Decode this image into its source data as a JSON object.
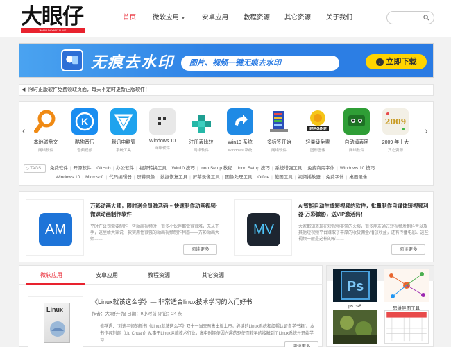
{
  "header": {
    "logo_text": "大眼仔",
    "logo_sub": "WWW.DAYANZAI.ME",
    "nav": [
      {
        "label": "首页",
        "active": true,
        "has_caret": false
      },
      {
        "label": "微软应用",
        "active": false,
        "has_caret": true
      },
      {
        "label": "安卓应用",
        "active": false,
        "has_caret": false
      },
      {
        "label": "教程资源",
        "active": false,
        "has_caret": false
      },
      {
        "label": "其它资源",
        "active": false,
        "has_caret": false
      },
      {
        "label": "关于我们",
        "active": false,
        "has_caret": false
      }
    ],
    "search_placeholder": ""
  },
  "banner": {
    "title": "无痕去水印",
    "subtitle": "图片、视频一键无痕去水印",
    "button": "立即下载",
    "accent": "#2a7be3",
    "button_color": "#ffd400"
  },
  "notice": {
    "text": "限时正版软件免费领取页面，每天不定时更新正版软件！"
  },
  "apps": [
    {
      "name": "本地磁盘文",
      "cat": "网络软件",
      "icon": "magnifier-icon"
    },
    {
      "name": "酷狗音乐",
      "cat": "音频视频",
      "icon": "kugou-icon"
    },
    {
      "name": "腾讯电脑管",
      "cat": "系统工具",
      "icon": "tencent-shield-icon"
    },
    {
      "name": "Windows 10",
      "cat": "网络软件",
      "icon": "windows-menu-icon"
    },
    {
      "name": "注册表比较",
      "cat": "网络软件",
      "icon": "registry-cubes-icon"
    },
    {
      "name": "Win10 系统",
      "cat": "Windows 系统",
      "icon": "win10-arrow-icon"
    },
    {
      "name": "多标签开始",
      "cat": "网络软件",
      "icon": "multi-tab-icon"
    },
    {
      "name": "轻量级免费",
      "cat": "图形图像",
      "icon": "imagine-icon"
    },
    {
      "name": "自动填表密",
      "cat": "网络软件",
      "icon": "roboform-icon"
    },
    {
      "name": "2009 年十大",
      "cat": "其它资源",
      "icon": "year-2009-icon"
    }
  ],
  "tags": {
    "label": "TAGS",
    "row1": [
      "免费软件",
      "开源软件",
      "GitHub",
      "办公软件",
      "视频转换工具",
      "Win10 技巧",
      "Inno Setup 教程",
      "Inno Setup 技巧",
      "系统增强工具",
      "免费商用字体",
      "Windows 10 技巧"
    ],
    "row2": [
      "Windows 10",
      "Microsoft",
      "代码编辑器",
      "屏幕录像",
      "数据恢复工具",
      "屏幕录像工具",
      "图像处理工具",
      "Office",
      "截图工具",
      "视频播放器",
      "免费字体",
      "桌面录像"
    ]
  },
  "featured": [
    {
      "icon_text": "AM",
      "icon_color": "#1e74d8",
      "title": "万彩动画大师，限时送会员激活码 – 快速制作动画视频·微课动画制作软件",
      "desc": "平时在公司需要制作一些动画视频时，很多小伙伴都觉得很难，无从下手，这里给大家说一款实用性很强的动画视频制作利器——万彩动画大师……",
      "more": "阅读更多"
    },
    {
      "icon_text": "MV",
      "icon_color": "#1d2530",
      "title": "AI智能自动生成短视频的软件，批量制作自媒体短视频利器·万彩微影，送VIP激活码！",
      "desc": "大家都知道现在短视频非常的火爆，很多朋友通过短视频发到抖音以及其他短视频平台赚取了丰厚的收货佣金/播放收益，还有传播电影、这些视频一般是这样的形……",
      "more": "阅读更多"
    }
  ],
  "tabs": [
    "微软应用",
    "安卓应用",
    "教程资源",
    "其它资源"
  ],
  "article": {
    "book_text": "Linux",
    "title": "《Linux就该这么学》— 非常适合linux技术学习的入门好书",
    "meta": "作者：大眼仔~旭 日期：9小时前 评论：24 条",
    "desc": "推荐语：\"刘遄老师的新书《Linux就该这么学》双十一当天预售出版上市。必读的Linux系统和红帽认证自学书籍\"。本书作者刘遄（Liu Chuan）从事于Linux运维技术行业，高中时期便因兴趣的驱使而较早的接触到了Linux系统并开始学习……",
    "more": "阅读更多"
  },
  "sidebar": [
    {
      "name": "ps cs6"
    },
    {
      "name": "思维导图工具"
    },
    {
      "name": ""
    },
    {
      "name": ""
    }
  ]
}
